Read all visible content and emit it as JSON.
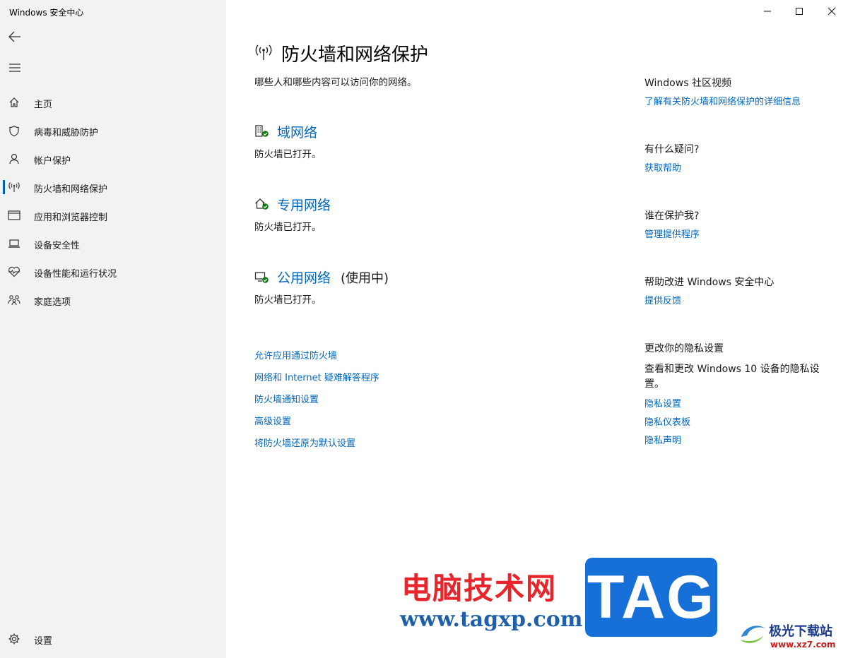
{
  "window": {
    "title": "Windows 安全中心"
  },
  "sidebar": {
    "items": [
      {
        "label": "主页"
      },
      {
        "label": "病毒和威胁防护"
      },
      {
        "label": "帐户保护"
      },
      {
        "label": "防火墙和网络保护"
      },
      {
        "label": "应用和浏览器控制"
      },
      {
        "label": "设备安全性"
      },
      {
        "label": "设备性能和运行状况"
      },
      {
        "label": "家庭选项"
      }
    ],
    "active_index": 3,
    "settings_label": "设置"
  },
  "main": {
    "title": "防火墙和网络保护",
    "description": "哪些人和哪些内容可以访问你的网络。",
    "networks": [
      {
        "name": "域网络",
        "suffix": "",
        "status": "防火墙已打开。"
      },
      {
        "name": "专用网络",
        "suffix": "",
        "status": "防火墙已打开。"
      },
      {
        "name": "公用网络",
        "suffix": "(使用中)",
        "status": "防火墙已打开。"
      }
    ],
    "links": [
      "允许应用通过防火墙",
      "网络和 Internet 疑难解答程序",
      "防火墙通知设置",
      "高级设置",
      "将防火墙还原为默认设置"
    ]
  },
  "right": {
    "community": {
      "heading": "Windows 社区视频",
      "link": "了解有关防火墙和网络保护的详细信息"
    },
    "question": {
      "heading": "有什么疑问?",
      "link": "获取帮助"
    },
    "protect": {
      "heading": "谁在保护我?",
      "link": "管理提供程序"
    },
    "improve": {
      "heading": "帮助改进 Windows 安全中心",
      "link": "提供反馈"
    },
    "privacy": {
      "heading": "更改你的隐私设置",
      "text": "查看和更改 Windows 10 设备的隐私设置。",
      "links": [
        "隐私设置",
        "隐私仪表板",
        "隐私声明"
      ]
    }
  },
  "watermark": {
    "site_name": "电脑技术网",
    "site_url": "www.tagxp.com",
    "tag": "TAG",
    "site2_name": "极光下载站",
    "site2_url": "www.xz7.com"
  },
  "colors": {
    "accent": "#0067c0",
    "sidebar_bg": "#f2f2f2",
    "status_ok": "#107c10"
  }
}
